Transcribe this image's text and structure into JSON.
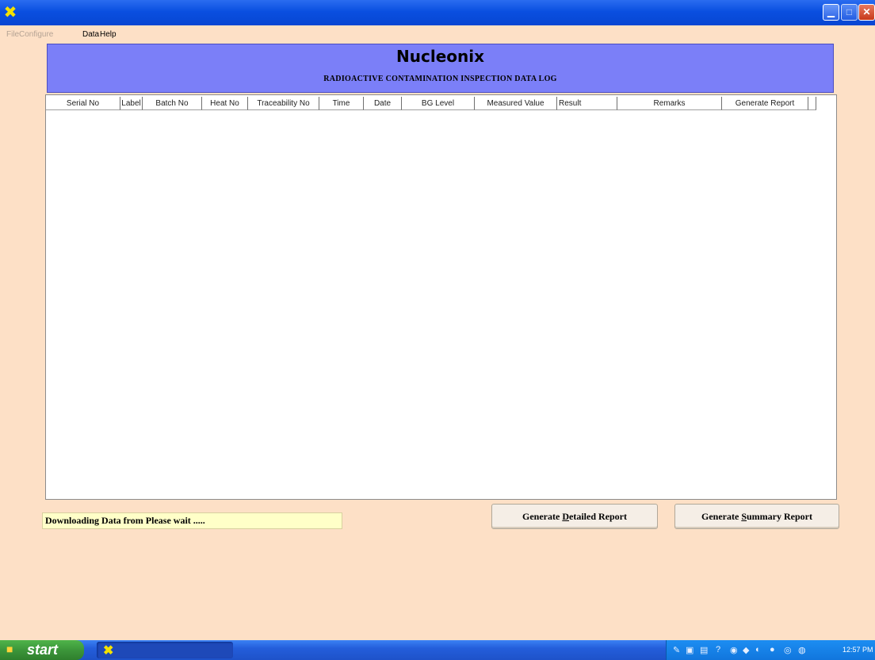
{
  "window": {
    "app_icon": "app-x-icon",
    "minimize_icon": "minimize-icon",
    "maximize_icon": "maximize-icon",
    "close_icon": "close-icon"
  },
  "menu": {
    "items": [
      {
        "label": "File",
        "enabled": false
      },
      {
        "label": "Configure",
        "enabled": false
      },
      {
        "label": "Data",
        "enabled": true
      },
      {
        "label": "Help",
        "enabled": true
      }
    ]
  },
  "header": {
    "brand": "Nucleonix",
    "subtitle": "RADIOACTIVE CONTAMINATION INSPECTION  DATA LOG",
    "background": "#7b7ff8"
  },
  "table": {
    "columns": [
      "Serial No",
      "Label",
      "Batch No",
      "Heat No",
      "Traceability No",
      "Time",
      "Date",
      "BG Level",
      "Measured Value",
      "Result",
      "Remarks",
      "Generate Report",
      ""
    ],
    "rows": []
  },
  "status": {
    "text": "Downloading Data from  Please wait  .....",
    "background": "#ffffc8"
  },
  "buttons": {
    "detailed": {
      "before": "Generate ",
      "mnemonic": "D",
      "after": "etailed Report"
    },
    "summary": {
      "before": "Generate ",
      "mnemonic": "S",
      "after": "ummary Report"
    }
  },
  "taskbar": {
    "start_label": "start",
    "clock": "12:57 PM"
  },
  "colors": {
    "background": "#fde0c6",
    "titlebar": "#0a4fe0",
    "taskbar": "#245edb"
  }
}
